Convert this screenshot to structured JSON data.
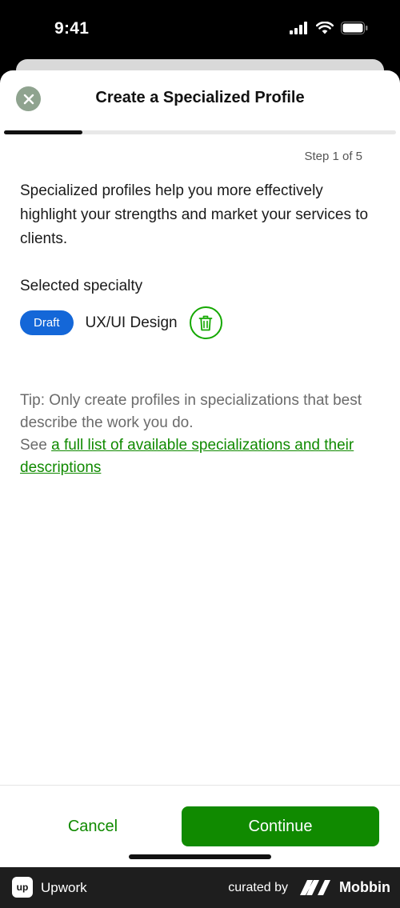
{
  "status_bar": {
    "time": "9:41"
  },
  "sheet": {
    "title": "Create a Specialized Profile",
    "step": "Step 1 of 5",
    "progress": 0.2,
    "intro": "Specialized profiles help you more effectively highlight your strengths and market your services to clients.",
    "selected_label": "Selected specialty",
    "badge": "Draft",
    "specialty": "UX/UI Design",
    "tip": {
      "text": "Tip: Only create profiles in specializations that best describe the work you do.",
      "see_prefix": "See",
      "link": "a full list of available specializations and their descriptions"
    }
  },
  "footer": {
    "cancel": "Cancel",
    "continue": "Continue"
  },
  "bottom_bar": {
    "app_logo": "up",
    "app_name": "Upwork",
    "curated_by": "curated by",
    "brand": "Mobbin"
  },
  "colors": {
    "accent_green": "#108a00",
    "badge_blue": "#1467d8",
    "close_gray": "#8fa38f"
  }
}
